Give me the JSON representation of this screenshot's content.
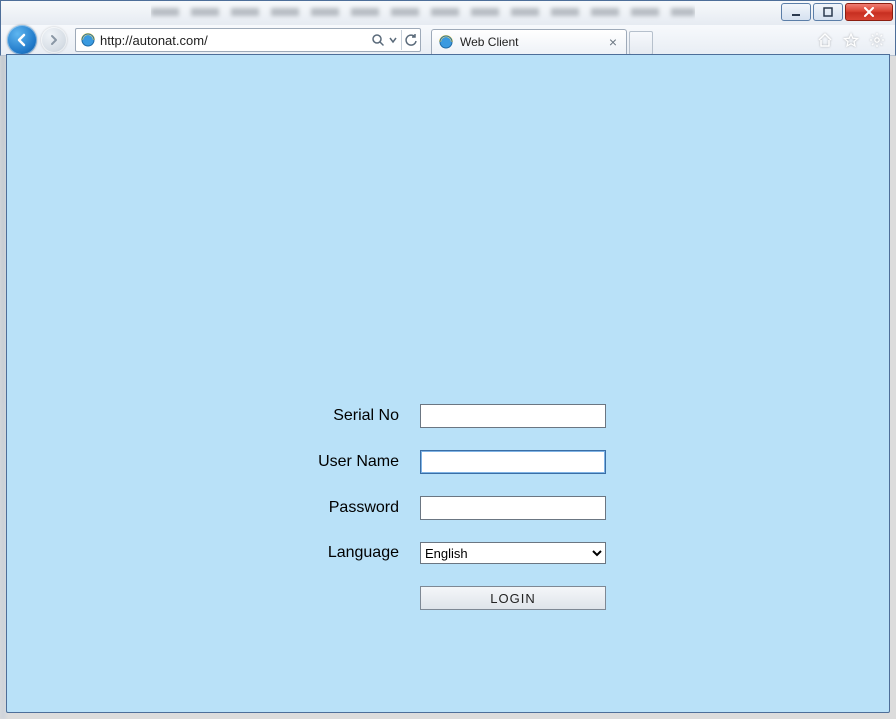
{
  "browser": {
    "address_url": "http://autonat.com/",
    "tab_title": "Web Client"
  },
  "caption": {
    "minimize_tip": "Minimize",
    "maximize_tip": "Maximize",
    "close_tip": "Close"
  },
  "toolbar_icons": {
    "home": "home-icon",
    "favorites": "star-icon",
    "tools": "gear-icon",
    "search": "search-icon",
    "refresh": "refresh-icon",
    "dropdown": "chevron-down-icon"
  },
  "login": {
    "labels": {
      "serial_no": "Serial No",
      "user_name": "User Name",
      "password": "Password",
      "language": "Language"
    },
    "values": {
      "serial_no": "",
      "user_name": "",
      "password": ""
    },
    "language_options": [
      "English"
    ],
    "language_selected": "English",
    "login_button": "LOGIN"
  }
}
